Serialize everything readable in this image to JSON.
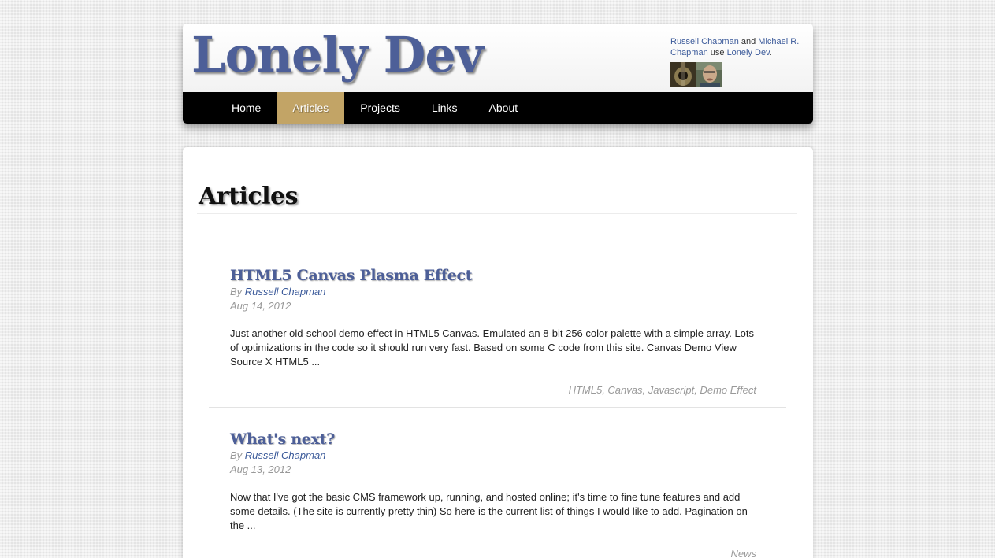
{
  "site": {
    "title": "Lonely Dev"
  },
  "authors": {
    "author1": "Russell Chapman",
    "and_text": " and ",
    "author2": "Michael R. Chapman",
    "use_text": " use ",
    "site_link": "Lonely Dev",
    "period": "."
  },
  "nav": {
    "items": [
      {
        "label": "Home",
        "active": false
      },
      {
        "label": "Articles",
        "active": true
      },
      {
        "label": "Projects",
        "active": false
      },
      {
        "label": "Links",
        "active": false
      },
      {
        "label": "About",
        "active": false
      }
    ]
  },
  "colors": {
    "accent": "#4d5f98",
    "nav_active": "#c2a466",
    "nav_bg": "#000000",
    "link": "#3b5a9a"
  },
  "page": {
    "heading": "Articles"
  },
  "articles": [
    {
      "title": "HTML5 Canvas Plasma Effect",
      "by_prefix": "By ",
      "author": "Russell Chapman",
      "date": "Aug 14, 2012",
      "excerpt": "Just another old-school demo effect in HTML5 Canvas. Emulated an 8-bit 256 color palette with a simple array. Lots of optimizations in the code so it should run very fast. Based on some C code from this site. Canvas Demo View Source X HTML5 ...",
      "tags": "HTML5, Canvas, Javascript, Demo Effect"
    },
    {
      "title": "What's next?",
      "by_prefix": "By ",
      "author": "Russell Chapman",
      "date": "Aug 13, 2012",
      "excerpt": "Now that I've got the basic CMS framework up, running, and hosted online; it's time to fine tune features and add some details. (The site is currently pretty thin) So here is the current list of things I would like to add. Pagination on the ...",
      "tags": "News"
    }
  ]
}
